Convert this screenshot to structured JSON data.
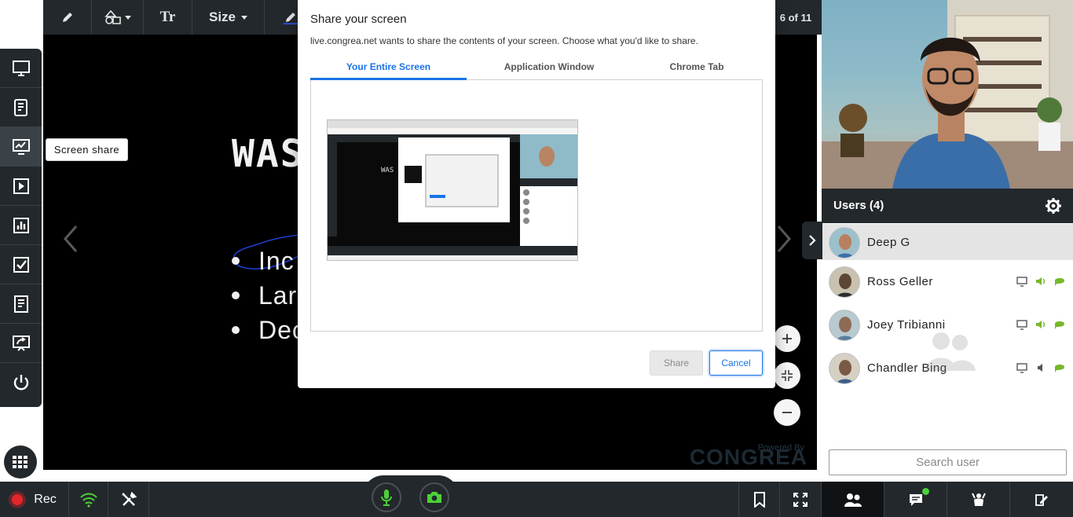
{
  "toolbar": {
    "tools": [
      "pencil-icon",
      "shapes-icon",
      "text-icon"
    ],
    "text_tool_label": "Tr",
    "size_label": "Size",
    "page_counter": "6 of 11"
  },
  "slide": {
    "title": "WAS",
    "bullets": [
      "Inc",
      "Lar",
      "Dec"
    ]
  },
  "sidebar": {
    "tooltip": "Screen share",
    "items": [
      "monitor-icon",
      "document-share-icon",
      "screen-share-icon",
      "video-play-icon",
      "poll-icon",
      "quiz-icon",
      "notes-icon",
      "presentation-share-icon",
      "power-icon"
    ]
  },
  "powered_by": {
    "line1": "Powered By",
    "logo": "CONGREA"
  },
  "dialog": {
    "title": "Share your screen",
    "description": "live.congrea.net wants to share the contents of your screen. Choose what you'd like to share.",
    "tabs": [
      "Your Entire Screen",
      "Application Window",
      "Chrome Tab"
    ],
    "active_tab": "Your Entire Screen",
    "share_label": "Share",
    "cancel_label": "Cancel"
  },
  "bottom_bar": {
    "rec_label": "Rec"
  },
  "users": {
    "header": "Users (4)",
    "list": [
      {
        "name": "Deep G",
        "is_self": true
      },
      {
        "name": "Ross Geller",
        "is_self": false
      },
      {
        "name": "Joey Tribianni",
        "is_self": false
      },
      {
        "name": "Chandler Bing",
        "is_self": false
      }
    ],
    "search_placeholder": "Search user"
  },
  "colors": {
    "panel_dark": "#23282c",
    "accent_blue": "#1a73e8",
    "status_green": "#76b82a",
    "rec_red": "#e3262a"
  }
}
